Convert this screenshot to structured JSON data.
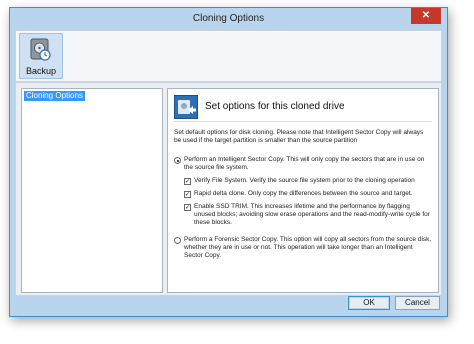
{
  "window": {
    "title": "Cloning Options",
    "close_glyph": "✕"
  },
  "toolbar": {
    "backup_label": "Backup",
    "backup_icon": "disk-clock-icon"
  },
  "left_pane": {
    "items": [
      "Cloning Options"
    ]
  },
  "right_pane": {
    "header": "Set options for this cloned drive",
    "header_icon": "clone-drive-icon",
    "intro": "Set default options for disk cloning. Please note that Intelligent Sector Copy will always be used if the target partition is smaller than the source partition",
    "intelligent": {
      "selected": true,
      "label": "Perform an Intelligent Sector Copy. This will only copy the sectors that are in use on the source file system.",
      "options": [
        {
          "checked": true,
          "label": "Verify File System. Verify the source file system prior to the cloning operation"
        },
        {
          "checked": true,
          "label": "Rapid delta clone. Only copy the differences between the source and target."
        },
        {
          "checked": true,
          "label": "Enable SSD TRIM. This increases lifetime and the performance by flagging unused blocks; avoiding slow erase operations and the read-modify-write cycle for these blocks."
        }
      ]
    },
    "forensic": {
      "selected": false,
      "label": "Perform a Forensic Sector Copy. This option will copy all sectors from the source disk, whether they are in use or not. This operation will take longer than an Intelligent Sector Copy."
    }
  },
  "buttons": {
    "ok": "OK",
    "cancel": "Cancel"
  },
  "colors": {
    "accent": "#3b8fd9",
    "selection": "#3399ff",
    "close": "#c7382b"
  }
}
